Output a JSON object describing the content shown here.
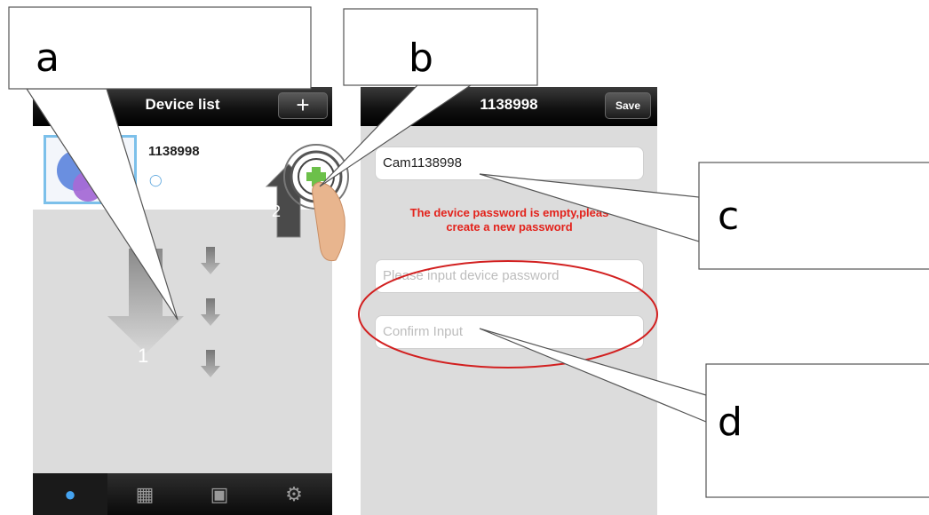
{
  "left_screen": {
    "title": "Device list",
    "add_button": "+",
    "device": {
      "name": "1138998",
      "status_icon": "person-icon"
    },
    "step_arrow_label": "1",
    "step_up_label": "2",
    "tabs": [
      "user-icon",
      "grid-icon",
      "toolbox-icon",
      "gear-icon"
    ]
  },
  "right_screen": {
    "title": "1138998",
    "save_button": "Save",
    "name_field": "Cam1138998",
    "warning_line1": "The device password is empty,pleas",
    "warning_line2": "create a new password",
    "password_placeholder": "Please input device password",
    "confirm_placeholder": "Confirm Input"
  },
  "callouts": {
    "a": "a",
    "b": "b",
    "c": "c",
    "d": "d"
  },
  "colors": {
    "accent_blue": "#45a3f0",
    "warning_red": "#e3221b",
    "add_green": "#6cc04a",
    "ellipse_red": "#d22020"
  }
}
